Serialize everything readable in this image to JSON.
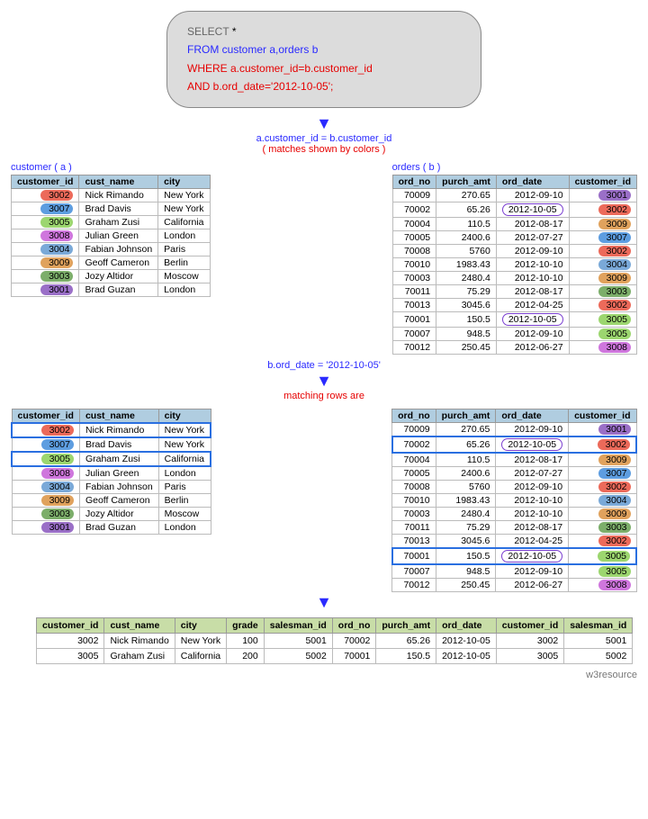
{
  "query": {
    "line1a": "SELECT ",
    "line1b": "*",
    "line2a": "FROM ",
    "line2b": "customer a,orders  b",
    "line3a": "WHERE ",
    "line3b": "a.customer_id=b.customer_id",
    "line4a": "AND ",
    "line4b": "b.ord_date='2012-10-05';"
  },
  "captions": {
    "join": "a.customer_id = b.customer_id",
    "join_sub": "( matches shown by colors )",
    "cust_title": "customer ( a )",
    "orders_title": "orders ( b )",
    "filter": "b.ord_date = '2012-10-05'",
    "matching": "matching rows are"
  },
  "cust_head": [
    "customer_id",
    "cust_name",
    "city"
  ],
  "customers": [
    {
      "id": "3002",
      "color": "c3002",
      "name": "Nick Rimando",
      "city": "New York"
    },
    {
      "id": "3007",
      "color": "c3007",
      "name": "Brad Davis",
      "city": "New York"
    },
    {
      "id": "3005",
      "color": "c3005",
      "name": "Graham Zusi",
      "city": "California"
    },
    {
      "id": "3008",
      "color": "c3008",
      "name": "Julian Green",
      "city": "London"
    },
    {
      "id": "3004",
      "color": "c3004",
      "name": "Fabian Johnson",
      "city": "Paris"
    },
    {
      "id": "3009",
      "color": "c3009",
      "name": "Geoff Cameron",
      "city": "Berlin"
    },
    {
      "id": "3003",
      "color": "c3003",
      "name": "Jozy Altidor",
      "city": "Moscow"
    },
    {
      "id": "3001",
      "color": "c3001",
      "name": "Brad Guzan",
      "city": "London"
    }
  ],
  "orders_head": [
    "ord_no",
    "purch_amt",
    "ord_date",
    "customer_id"
  ],
  "orders": [
    {
      "no": "70009",
      "amt": "270.65",
      "date": "2012-09-10",
      "cid": "3001",
      "color": "c3001"
    },
    {
      "no": "70002",
      "amt": "65.26",
      "date": "2012-10-05",
      "cid": "3002",
      "color": "c3002",
      "ring": true
    },
    {
      "no": "70004",
      "amt": "110.5",
      "date": "2012-08-17",
      "cid": "3009",
      "color": "c3009"
    },
    {
      "no": "70005",
      "amt": "2400.6",
      "date": "2012-07-27",
      "cid": "3007",
      "color": "c3007"
    },
    {
      "no": "70008",
      "amt": "5760",
      "date": "2012-09-10",
      "cid": "3002",
      "color": "c3002"
    },
    {
      "no": "70010",
      "amt": "1983.43",
      "date": "2012-10-10",
      "cid": "3004",
      "color": "c3004"
    },
    {
      "no": "70003",
      "amt": "2480.4",
      "date": "2012-10-10",
      "cid": "3009",
      "color": "c3009"
    },
    {
      "no": "70011",
      "amt": "75.29",
      "date": "2012-08-17",
      "cid": "3003",
      "color": "c3003"
    },
    {
      "no": "70013",
      "amt": "3045.6",
      "date": "2012-04-25",
      "cid": "3002",
      "color": "c3002"
    },
    {
      "no": "70001",
      "amt": "150.5",
      "date": "2012-10-05",
      "cid": "3005",
      "color": "c3005",
      "ring": true
    },
    {
      "no": "70007",
      "amt": "948.5",
      "date": "2012-09-10",
      "cid": "3005",
      "color": "c3005"
    },
    {
      "no": "70012",
      "amt": "250.45",
      "date": "2012-06-27",
      "cid": "3008",
      "color": "c3008"
    }
  ],
  "cust_match_rows": [
    "3002",
    "3005"
  ],
  "orders_match_rows": [
    "70002",
    "70001"
  ],
  "result_head": [
    "customer_id",
    "cust_name",
    "city",
    "grade",
    "salesman_id",
    "ord_no",
    "purch_amt",
    "ord_date",
    "customer_id",
    "salesman_id"
  ],
  "result": [
    [
      "3002",
      "Nick Rimando",
      "New York",
      "100",
      "5001",
      "70002",
      "65.26",
      "2012-10-05",
      "3002",
      "5001"
    ],
    [
      "3005",
      "Graham Zusi",
      "California",
      "200",
      "5002",
      "70001",
      "150.5",
      "2012-10-05",
      "3005",
      "5002"
    ]
  ],
  "footer": "w3resource"
}
